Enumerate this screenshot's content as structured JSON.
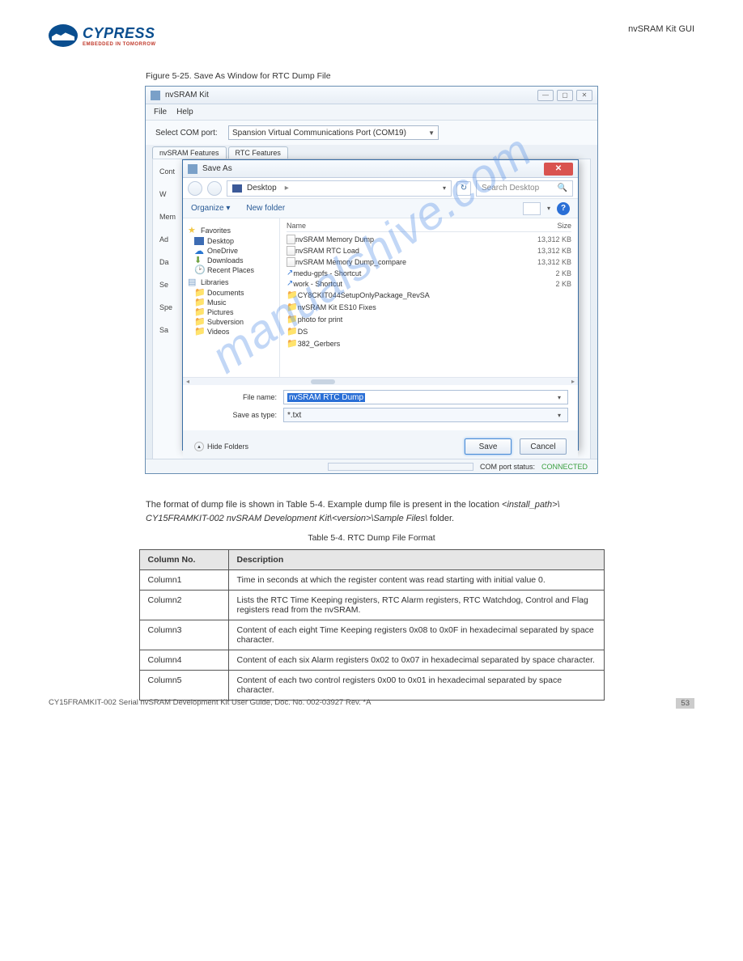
{
  "logo": {
    "brand": "CYPRESS",
    "tagline": "EMBEDDED IN TOMORROW"
  },
  "headerRight": "nvSRAM Kit GUI",
  "figCaption": "Figure 5-25. Save As Window for RTC Dump File",
  "app": {
    "title": "nvSRAM Kit",
    "menu": {
      "file": "File",
      "help": "Help"
    },
    "portLabel": "Select COM port:",
    "portValue": "Spansion Virtual Communications Port (COM19)",
    "tabs": [
      "nvSRAM Features",
      "RTC Features"
    ],
    "leftLabels": [
      "Cont",
      "W",
      "Mem",
      "Ad",
      "Da",
      "Se",
      "Spe",
      "Sa"
    ],
    "status": {
      "label": "COM port status:",
      "value": "CONNECTED"
    }
  },
  "saveDialog": {
    "title": "Save As",
    "path": "Desktop",
    "searchPlaceholder": "Search Desktop",
    "organize": "Organize",
    "newFolder": "New folder",
    "sideFavorites": "Favorites",
    "sideItemsFav": [
      "Desktop",
      "OneDrive",
      "Downloads",
      "Recent Places"
    ],
    "sideLibraries": "Libraries",
    "sideItemsLib": [
      "Documents",
      "Music",
      "Pictures",
      "Subversion",
      "Videos"
    ],
    "cols": {
      "name": "Name",
      "size": "Size"
    },
    "files": [
      {
        "name": "nvSRAM Memory Dump",
        "size": "13,312 KB",
        "icon": "txt"
      },
      {
        "name": "nvSRAM RTC Load",
        "size": "13,312 KB",
        "icon": "txt"
      },
      {
        "name": "nvSRAM Memory Dump_compare",
        "size": "13,312 KB",
        "icon": "txt"
      },
      {
        "name": "medu-gpfs - Shortcut",
        "size": "2 KB",
        "icon": "sc"
      },
      {
        "name": "work - Shortcut",
        "size": "2 KB",
        "icon": "sc"
      },
      {
        "name": "CY8CKIT044SetupOnlyPackage_RevSA",
        "size": "",
        "icon": "fd"
      },
      {
        "name": "nvSRAM Kit ES10 Fixes",
        "size": "",
        "icon": "fd"
      },
      {
        "name": "photo for print",
        "size": "",
        "icon": "fd"
      },
      {
        "name": "DS",
        "size": "",
        "icon": "fd"
      },
      {
        "name": "382_Gerbers",
        "size": "",
        "icon": "fd"
      }
    ],
    "fileNameLabel": "File name:",
    "fileNameValue": "nvSRAM RTC Dump",
    "saveTypeLabel": "Save as type:",
    "saveTypeValue": "*.txt",
    "hideFolders": "Hide Folders",
    "save": "Save",
    "cancel": "Cancel"
  },
  "dumpText": {
    "l1": "The format of dump file is shown in Table 5-4. Example dump file is present in the location ",
    "file": "<install_path>\\ CY15FRAMKIT-002 nvSRAM Development Kit\\<version>\\Sample Files\\",
    "l2": " folder."
  },
  "tableCaption": "Table 5-4. RTC Dump File Format",
  "table": {
    "headers": [
      "Column No.",
      "Description"
    ],
    "rows": [
      [
        "Column1",
        "Time in seconds at which the register content was read starting with initial value 0."
      ],
      [
        "Column2",
        "Lists the RTC Time Keeping registers, RTC Alarm registers, RTC Watchdog, Control and Flag registers read from the nvSRAM."
      ],
      [
        "Column3",
        "Content of each eight Time Keeping registers 0x08 to 0x0F in hexadecimal separated by space character."
      ],
      [
        "Column4",
        "Content of each six Alarm registers 0x02 to 0x07 in hexadecimal separated by space character."
      ],
      [
        "Column5",
        "Content of each two control registers 0x00 to 0x01 in hexadecimal separated by space character."
      ]
    ]
  },
  "watermark": "manualshive.com",
  "footer": {
    "left": "CY15FRAMKIT-002 Serial nvSRAM Development Kit User Guide, Doc. No. 002-03927 Rev. *A",
    "page": "53"
  }
}
